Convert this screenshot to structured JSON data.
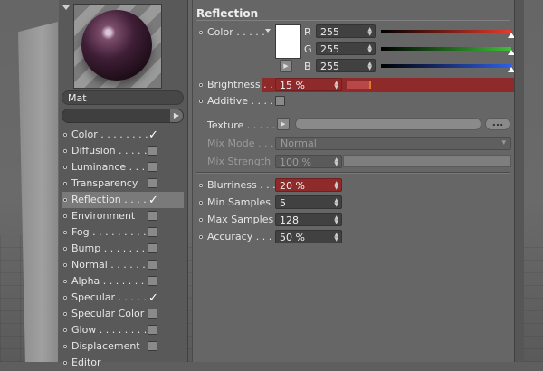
{
  "material": {
    "name": "Mat",
    "channels": [
      {
        "label": "Color . . . . . . . .",
        "checked": true,
        "active": false
      },
      {
        "label": "Diffusion . . . . .",
        "checked": false,
        "active": false
      },
      {
        "label": "Luminance . . . .",
        "checked": false,
        "active": false
      },
      {
        "label": "Transparency",
        "checked": false,
        "active": false
      },
      {
        "label": "Reflection . . . .",
        "checked": true,
        "active": true
      },
      {
        "label": "Environment",
        "checked": false,
        "active": false
      },
      {
        "label": "Fog . . . . . . . . .",
        "checked": false,
        "active": false
      },
      {
        "label": "Bump . . . . . . . .",
        "checked": false,
        "active": false
      },
      {
        "label": "Normal . . . . . .",
        "checked": false,
        "active": false
      },
      {
        "label": "Alpha . . . . . . . .",
        "checked": false,
        "active": false
      },
      {
        "label": "Specular . . . . .",
        "checked": true,
        "active": false
      },
      {
        "label": "Specular Color",
        "checked": false,
        "active": false
      },
      {
        "label": "Glow . . . . . . . . .",
        "checked": false,
        "active": false
      },
      {
        "label": "Displacement",
        "checked": false,
        "active": false
      },
      {
        "label": "Editor",
        "checked": false,
        "active": false
      }
    ]
  },
  "reflection": {
    "title": "Reflection",
    "color_label": "Color . . . . .",
    "color_hex": "#ffffff",
    "r_label": "R",
    "r_value": "255",
    "r_fraction": 1.0,
    "g_label": "G",
    "g_value": "255",
    "g_fraction": 1.0,
    "b_label": "B",
    "b_value": "255",
    "b_fraction": 1.0,
    "brightness_label": "Brightness . . . .",
    "brightness_value": "15 %",
    "brightness_fraction": 0.15,
    "additive_label": "Additive . . . .",
    "texture_label": "Texture . . . . .",
    "texture_more": "...",
    "mix_mode_label": "Mix Mode . . .",
    "mix_mode_value": "Normal",
    "mix_strength_label": "Mix Strength",
    "mix_strength_value": "100 %",
    "blurriness_label": "Blurriness . . . .",
    "blurriness_value": "20 %",
    "min_samples_label": "Min Samples",
    "min_samples_value": "5",
    "max_samples_label": "Max Samples",
    "max_samples_value": "128",
    "accuracy_label": "Accuracy . . . .",
    "accuracy_value": "50 %"
  },
  "colors": {
    "highlight_red": "#8f2a2a",
    "panel_bg": "#666666",
    "red_gradient": "#e63b2e",
    "green_gradient": "#3fbf3a",
    "blue_gradient": "#2f5fe6"
  },
  "icons": {
    "collapse": "triangle-down",
    "spinner": "up-down-arrows",
    "play": "right-arrow",
    "dropdown": "chevron-down"
  }
}
